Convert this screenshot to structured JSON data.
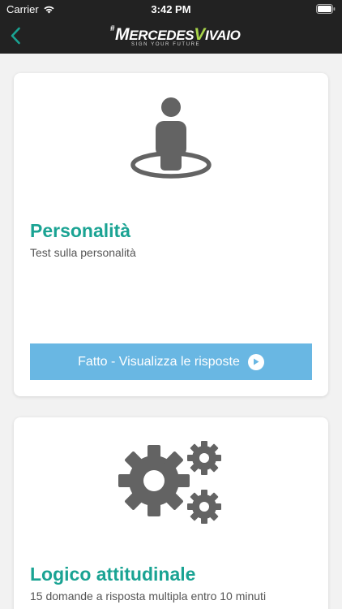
{
  "status_bar": {
    "carrier": "Carrier",
    "time": "3:42 PM"
  },
  "header": {
    "logo": {
      "hash": "#",
      "initial": "M",
      "word_a": "ERCEDES",
      "initial_b": "V",
      "word_b": "IVAIO",
      "tagline": "SIGN YOUR FUTURE"
    }
  },
  "cards": [
    {
      "icon": "person-location-icon",
      "title": "Personalità",
      "description": "Test sulla personalità",
      "button_label": "Fatto - Visualizza le risposte"
    },
    {
      "icon": "gears-icon",
      "title": "Logico attitudinale",
      "description": "15 domande a risposta multipla entro 10 minuti"
    }
  ],
  "colors": {
    "bar": "#222222",
    "accent": "#1aa393",
    "button": "#69b7e3",
    "icon": "#636363",
    "back": "#1aa393",
    "logo_v": "#a8d44a"
  }
}
